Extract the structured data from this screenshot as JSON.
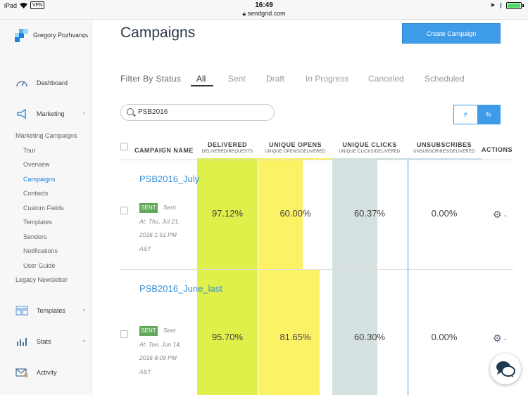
{
  "status_bar": {
    "device": "iPad",
    "vpn": "VPN",
    "time": "16:49",
    "url": "sendgrid.com"
  },
  "sidebar": {
    "account_name": "Gregory Pozhvanov",
    "nav": [
      {
        "label": "Dashboard",
        "icon": "gauge-icon"
      },
      {
        "label": "Marketing",
        "icon": "megaphone-icon"
      },
      {
        "label": "Templates",
        "icon": "templates-icon"
      },
      {
        "label": "Stats",
        "icon": "stats-icon"
      },
      {
        "label": "Activity",
        "icon": "activity-icon"
      }
    ],
    "section_title": "Marketing Campaigns",
    "sub_items": [
      "Tour",
      "Overview",
      "Campaigns",
      "Contacts",
      "Custom Fields",
      "Templates",
      "Senders",
      "Notifications",
      "User Guide"
    ],
    "active_sub_item": "Campaigns",
    "legacy": "Legacy Newsletter"
  },
  "main": {
    "title": "Campaigns",
    "create_button": "Create Campaign",
    "filter_label": "Filter By Status",
    "filter_tabs": [
      "All",
      "Sent",
      "Draft",
      "In Progress",
      "Canceled",
      "Scheduled"
    ],
    "active_filter": "All",
    "search_value": "PSB2016",
    "toggle": {
      "count": "#",
      "percent": "%"
    }
  },
  "table": {
    "headers": {
      "name": "CAMPAIGN NAME",
      "delivered": "DELIVERED",
      "delivered_sub": "DELIVERED/REQUESTS",
      "opens": "UNIQUE OPENS",
      "opens_sub": "UNIQUE OPENS/DELIVERED",
      "clicks": "UNIQUE CLICKS",
      "clicks_sub": "UNIQUE CLICKS/DELIVERED",
      "unsubs": "UNSUBSCRIBES",
      "unsubs_sub": "UNSUBSCRIBES/DELIVERED",
      "actions": "ACTIONS"
    },
    "colors": {
      "delivered": "#dff04a",
      "opens": "#fcf266",
      "clicks": "#d5e0e0",
      "unsubs": "#c9e1f5"
    },
    "rows": [
      {
        "name": "PSB2016_July",
        "status": "SENT",
        "sent_at": "Sent At: Thu, Jul 21, 2016 1:51 PM AST",
        "delivered": "97.12%",
        "opens": "60.00%",
        "clicks": "60.37%",
        "unsubs": "0.00%",
        "delivered_rate": 0.9712,
        "opens_rate": 0.6,
        "clicks_rate": 0.6037,
        "unsubs_rate": 0.0
      },
      {
        "name": "PSB2016_June_last",
        "status": "SENT",
        "sent_at": "Sent At: Tue, Jun 14, 2016 8:09 PM AST",
        "delivered": "95.70%",
        "opens": "81.65%",
        "clicks": "60.30%",
        "unsubs": "0.00%",
        "delivered_rate": 0.957,
        "opens_rate": 0.8165,
        "clicks_rate": 0.603,
        "unsubs_rate": 0.0
      }
    ]
  }
}
